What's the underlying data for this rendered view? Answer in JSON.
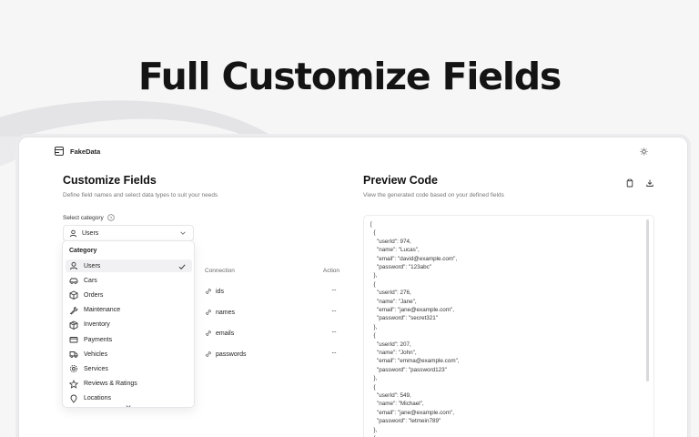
{
  "hero": {
    "title": "Full Customize Fields"
  },
  "app": {
    "name": "FakeData"
  },
  "customize": {
    "title": "Customize Fields",
    "subtitle": "Define field names and select data types to suit your needs",
    "category_label": "Select category",
    "selected_category": "Users",
    "table": {
      "col_connection": "Connection",
      "col_action": "Action",
      "rows": [
        "ids",
        "names",
        "emails",
        "passwords"
      ],
      "action_glyph": "···"
    }
  },
  "dropdown": {
    "header": "Category",
    "items": [
      {
        "label": "Users",
        "icon": "user-icon",
        "selected": true
      },
      {
        "label": "Cars",
        "icon": "car-icon"
      },
      {
        "label": "Orders",
        "icon": "box-icon"
      },
      {
        "label": "Maintenance",
        "icon": "wrench-icon"
      },
      {
        "label": "Inventory",
        "icon": "package-icon"
      },
      {
        "label": "Payments",
        "icon": "credit-card-icon"
      },
      {
        "label": "Vehicles",
        "icon": "truck-icon"
      },
      {
        "label": "Services",
        "icon": "gear-icon"
      },
      {
        "label": "Reviews & Ratings",
        "icon": "star-icon"
      },
      {
        "label": "Locations",
        "icon": "pin-icon"
      }
    ]
  },
  "preview": {
    "title": "Preview Code",
    "subtitle": "View the generated code based on your defined fields",
    "code_lines": [
      "[",
      "  {",
      "    \"userId\": 974,",
      "    \"name\": \"Lucas\",",
      "    \"email\": \"david@example.com\",",
      "    \"password\": \"123abc\"",
      "  },",
      "  {",
      "    \"userId\": 276,",
      "    \"name\": \"Jane\",",
      "    \"email\": \"jane@example.com\",",
      "    \"password\": \"secret321\"",
      "  },",
      "  {",
      "    \"userId\": 207,",
      "    \"name\": \"John\",",
      "    \"email\": \"emma@example.com\",",
      "    \"password\": \"password123\"",
      "  },",
      "  {",
      "    \"userId\": 549,",
      "    \"name\": \"Michael\",",
      "    \"email\": \"jane@example.com\",",
      "    \"password\": \"letmein789\"",
      "  },",
      "  {"
    ]
  },
  "colors": {
    "background": "#f6f6f7",
    "panel": "#ffffff",
    "text": "#141414",
    "muted": "#777777",
    "selected_row": "#f1f1f3"
  }
}
